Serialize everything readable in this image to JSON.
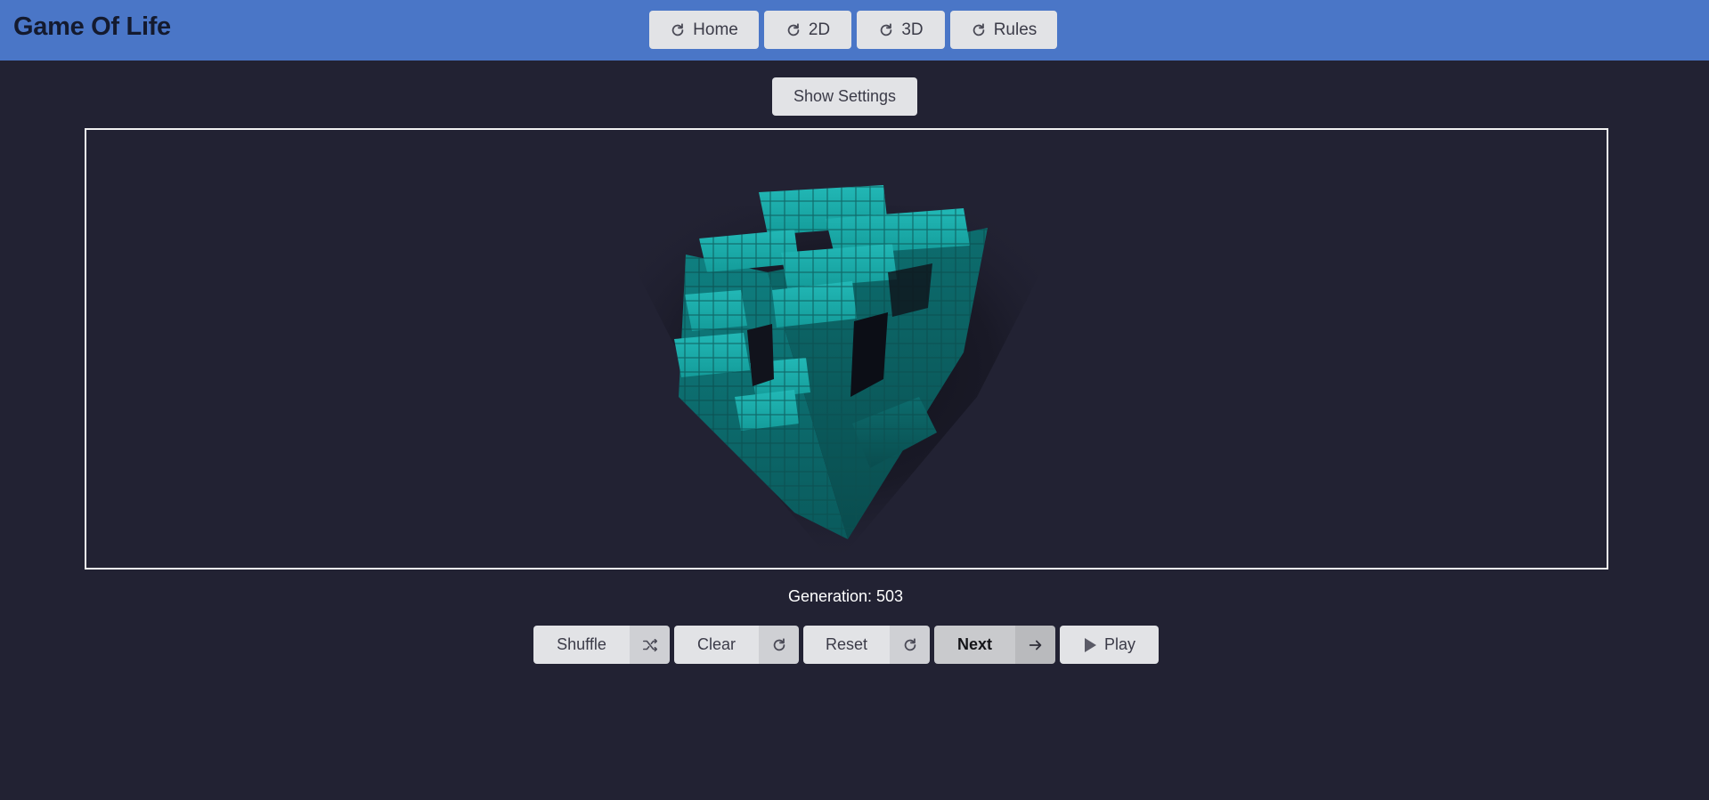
{
  "header": {
    "brand": "Game Of Life",
    "background": "#4a76c7",
    "nav": [
      {
        "label": "Home",
        "icon": "redo-icon"
      },
      {
        "label": "2D",
        "icon": "redo-icon"
      },
      {
        "label": "3D",
        "icon": "redo-icon"
      },
      {
        "label": "Rules",
        "icon": "redo-icon"
      }
    ]
  },
  "settings": {
    "toggle_label": "Show Settings"
  },
  "viewport": {
    "description_icon": "3d-cell-grid",
    "cell_color": "#1aa0a0"
  },
  "status": {
    "generation": "Generation: 503"
  },
  "controls": {
    "shuffle": {
      "label": "Shuffle",
      "icon": "shuffle-icon"
    },
    "clear": {
      "label": "Clear",
      "icon": "redo-icon"
    },
    "reset": {
      "label": "Reset",
      "icon": "redo-icon"
    },
    "next": {
      "label": "Next",
      "icon": "arrow-right-icon"
    },
    "play": {
      "label": "Play",
      "icon": "play-icon"
    }
  },
  "colors": {
    "page_bg": "#222233",
    "button_bg": "#e2e3e6"
  }
}
